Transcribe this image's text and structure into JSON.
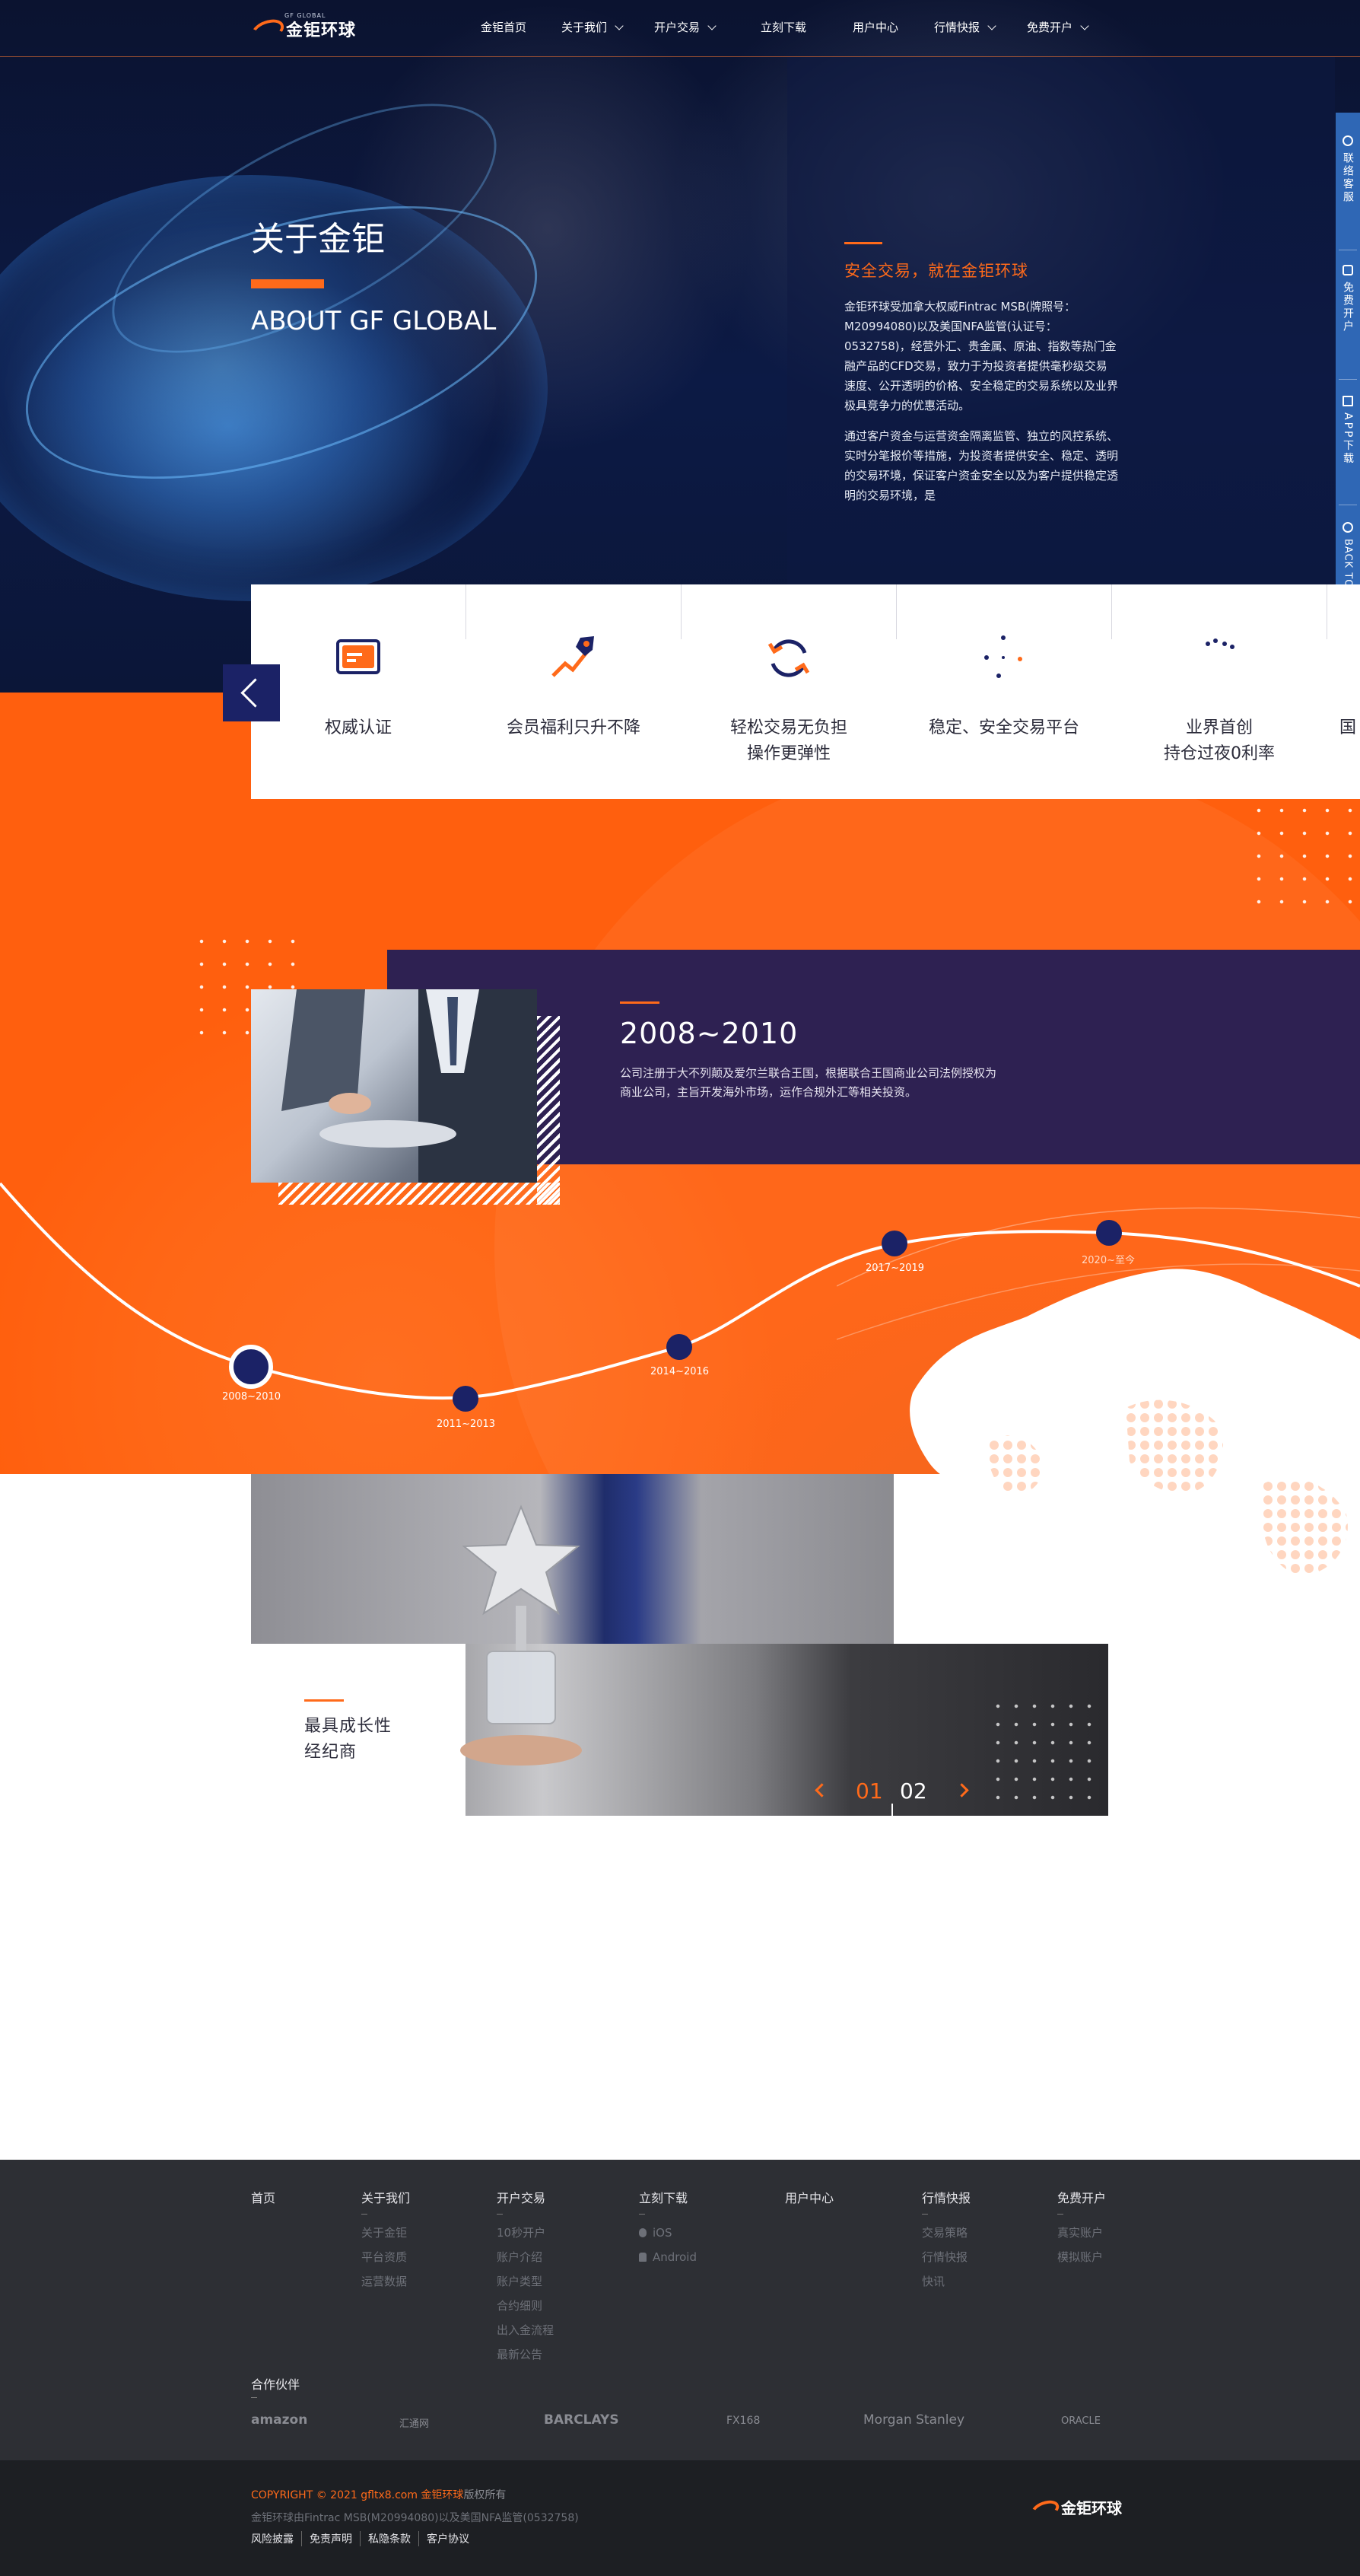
{
  "logo": {
    "text": "金钜环球",
    "small_text": "GF GLOBAL"
  },
  "nav": {
    "items": [
      {
        "label": "金钜首页",
        "has_dropdown": false
      },
      {
        "label": "关于我们",
        "has_dropdown": true
      },
      {
        "label": "开户交易",
        "has_dropdown": true
      },
      {
        "label": "立刻下载",
        "has_dropdown": false
      },
      {
        "label": "用户中心",
        "has_dropdown": false
      },
      {
        "label": "行情快报",
        "has_dropdown": true
      },
      {
        "label": "免费开户",
        "has_dropdown": true
      }
    ]
  },
  "about": {
    "title": "关于金钜",
    "subtitle": "ABOUT GF GLOBAL",
    "slogan": "安全交易，就在金钜环球",
    "paragraphs": [
      "金钜环球受加拿大权威Fintrac MSB(牌照号：M20994080)以及美国NFA监管(认证号：0532758)，经营外汇、贵金属、原油、指数等热门金融产品的CFD交易，致力于为投资者提供毫秒级交易速度、公开透明的价格、安全稳定的交易系统以及业界极具竞争力的优惠活动。",
      "通过客户资金与运营资金隔离监管、独立的风控系统、实时分笔报价等措施，为投资者提供安全、稳定、透明的交易环境，保证客户资金安全以及为客户提供稳定透明的交易环境，是"
    ]
  },
  "sidebar": {
    "items": [
      {
        "label": "联络客服",
        "icon": "headset-icon"
      },
      {
        "label": "免费开户",
        "icon": "phone-icon"
      },
      {
        "label": "APP下载",
        "icon": "app-icon"
      },
      {
        "label": "BACK TO TOP",
        "icon": "arrow-up-icon"
      }
    ]
  },
  "features": [
    {
      "label": "权威认证",
      "icon": "certificate-icon"
    },
    {
      "label": "会员福利只升不降",
      "icon": "rocket-chart-icon"
    },
    {
      "label": "轻松交易无负担\n操作更弹性",
      "icon": "refresh-icon"
    },
    {
      "label": "稳定、安全交易平台",
      "icon": "network-icon"
    },
    {
      "label": "业界首创\n持仓过夜0利率",
      "icon": "dots-icon"
    },
    {
      "label": "国",
      "icon": "partial-icon"
    }
  ],
  "history": {
    "year": "2008~2010",
    "text": "公司注册于大不列颠及爱尔兰联合王国，根据联合王国商业公司法例授权为商业公司，主旨开发海外市场，运作合规外汇等相关投资。",
    "timeline": [
      "2008~2010",
      "2011~2013",
      "2014~2016",
      "2017~2019",
      "2020~至今"
    ]
  },
  "award": {
    "title": "最具成长性\n经纪商",
    "current_page": "01",
    "total_pages": "02"
  },
  "footer": {
    "columns": [
      {
        "heading": "首页",
        "items": []
      },
      {
        "heading": "关于我们",
        "items": [
          "关于金钜",
          "平台资质",
          "运营数据"
        ]
      },
      {
        "heading": "开户交易",
        "items": [
          "10秒开户",
          "账户介绍",
          "账户类型",
          "合约细则",
          "出入金流程",
          "最新公告"
        ]
      },
      {
        "heading": "立刻下载",
        "items": [
          "iOS",
          "Android"
        ]
      },
      {
        "heading": "用户中心",
        "items": []
      },
      {
        "heading": "行情快报",
        "items": [
          "交易策略",
          "行情快报",
          "快讯"
        ]
      },
      {
        "heading": "免费开户",
        "items": [
          "真实账户",
          "模拟账户"
        ]
      }
    ],
    "partners_heading": "合作伙伴",
    "partners": [
      "amazon",
      "汇通网",
      "BARCLAYS",
      "FX168",
      "Morgan Stanley",
      "ORACLE"
    ],
    "copyright_orange": "COPYRIGHT © 2021 gfltx8.com 金钜环球",
    "copyright_gray": "版权所有",
    "license": "金钜环球由Fintrac MSB(M20994080)以及美国NFA监管(0532758)",
    "legal_links": [
      "风险披露",
      "免责声明",
      "私隐条款",
      "客户协议"
    ]
  },
  "colors": {
    "accent": "#ff6a1a",
    "navy": "#1b2266",
    "purple": "#2e2152",
    "footer": "#2d2f34",
    "sidebar": "#2f67b5"
  }
}
